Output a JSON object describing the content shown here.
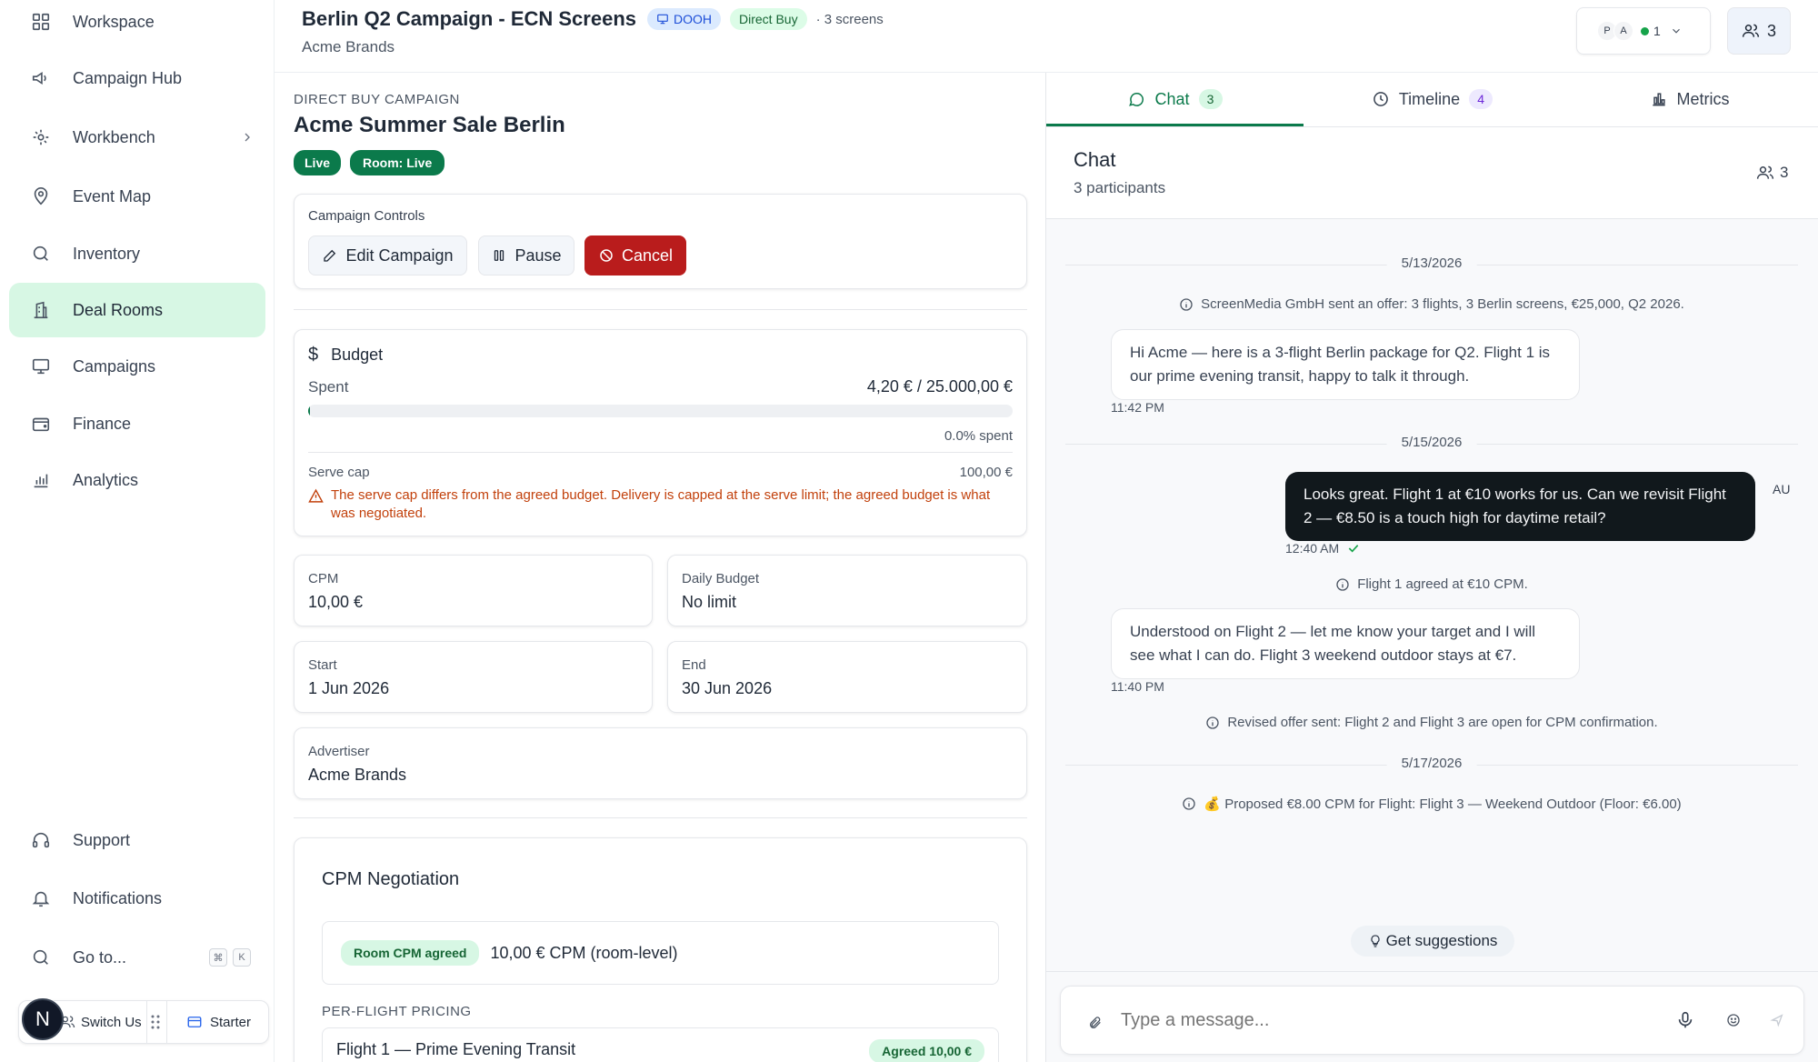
{
  "sidebar": {
    "items": [
      {
        "label": "Workspace",
        "icon": "grid-icon"
      },
      {
        "label": "Campaign Hub",
        "icon": "megaphone-icon"
      },
      {
        "label": "Workbench",
        "icon": "workbench-icon"
      },
      {
        "label": "Event Map",
        "icon": "map-pin-icon"
      },
      {
        "label": "Inventory",
        "icon": "search-icon"
      },
      {
        "label": "Deal Rooms",
        "icon": "building-icon"
      },
      {
        "label": "Campaigns",
        "icon": "monitor-icon"
      },
      {
        "label": "Finance",
        "icon": "wallet-icon"
      },
      {
        "label": "Analytics",
        "icon": "bar-chart-icon"
      }
    ],
    "active": "Deal Rooms",
    "bottom": {
      "support": "Support",
      "notifications": "Notifications",
      "goto": "Go to...",
      "goto_keys": [
        "⌘",
        "K"
      ],
      "avatar_initial": "N",
      "switch_user": "Switch Us",
      "plan": "Starter"
    }
  },
  "header": {
    "title": "Berlin Q2 Campaign - ECN Screens",
    "badge_dooh": "DOOH",
    "badge_direct": "Direct Buy",
    "screens": "· 3 screens",
    "subtitle": "Acme Brands",
    "presence_initials": [
      "P",
      "A"
    ],
    "presence_count": "1",
    "participants_count": "3"
  },
  "campaign": {
    "kind": "DIRECT BUY CAMPAIGN",
    "name": "Acme Summer Sale Berlin",
    "status": "Live",
    "room_status": "Room: Live",
    "controls_title": "Campaign Controls",
    "edit": "Edit Campaign",
    "pause": "Pause",
    "cancel": "Cancel"
  },
  "budget": {
    "title": "Budget",
    "spent_label": "Spent",
    "spent_value": "4,20 € / 25.000,00 €",
    "spent_fraction": 0.000168,
    "spent_pct": "0.0% spent",
    "serve_cap_label": "Serve cap",
    "serve_cap_value": "100,00 €",
    "warning": "The serve cap differs from the agreed budget. Delivery is capped at the serve limit; the agreed budget is what was negotiated."
  },
  "details": {
    "cpm_label": "CPM",
    "cpm_value": "10,00 €",
    "daily_label": "Daily Budget",
    "daily_value": "No limit",
    "start_label": "Start",
    "start_value": "1 Jun 2026",
    "end_label": "End",
    "end_value": "30 Jun 2026",
    "advertiser_label": "Advertiser",
    "advertiser_value": "Acme Brands"
  },
  "negotiation": {
    "title": "CPM Negotiation",
    "room_badge": "Room CPM agreed",
    "room_value": "10,00 € CPM (room-level)",
    "per_flight_label": "PER-FLIGHT PRICING",
    "flights": [
      {
        "name": "Flight 1 — Prime Evening Transit",
        "status": "Agreed 10,00 €"
      }
    ]
  },
  "tabs": [
    {
      "label": "Chat",
      "count": "3"
    },
    {
      "label": "Timeline",
      "count": "4"
    },
    {
      "label": "Metrics",
      "count": ""
    }
  ],
  "chat": {
    "title": "Chat",
    "participants": "3 participants",
    "participants_count": "3",
    "dates": [
      "5/13/2026",
      "5/15/2026",
      "5/17/2026"
    ],
    "system": [
      "ScreenMedia GmbH sent an offer: 3 flights, 3 Berlin screens, €25,000, Q2 2026.",
      "Flight 1 agreed at €10 CPM.",
      "Revised offer sent: Flight 2 and Flight 3 are open for CPM confirmation.",
      "💰 Proposed €8.00 CPM for Flight: Flight 3 — Weekend Outdoor (Floor: €6.00)"
    ],
    "messages": [
      {
        "text": "Hi Acme — here is a 3-flight Berlin package for Q2. Flight 1 is our prime evening transit, happy to talk it through.",
        "time": "11:42 PM"
      },
      {
        "text": "Looks great. Flight 1 at €10 works for us. Can we revisit Flight 2 — €8.50 is a touch high for daytime retail?",
        "time": "12:40 AM",
        "sender": "AU"
      },
      {
        "text": "Understood on Flight 2 — let me know your target and I will see what I can do. Flight 3 weekend outdoor stays at €7.",
        "time": "11:40 PM"
      }
    ],
    "suggestions": "Get suggestions",
    "input_placeholder": "Type a message..."
  },
  "colors": {
    "accent_green": "#0b7a4b",
    "cancel_red": "#b91c1c",
    "warning_orange": "#c2410c",
    "active_nav": "#d7f7e4"
  }
}
